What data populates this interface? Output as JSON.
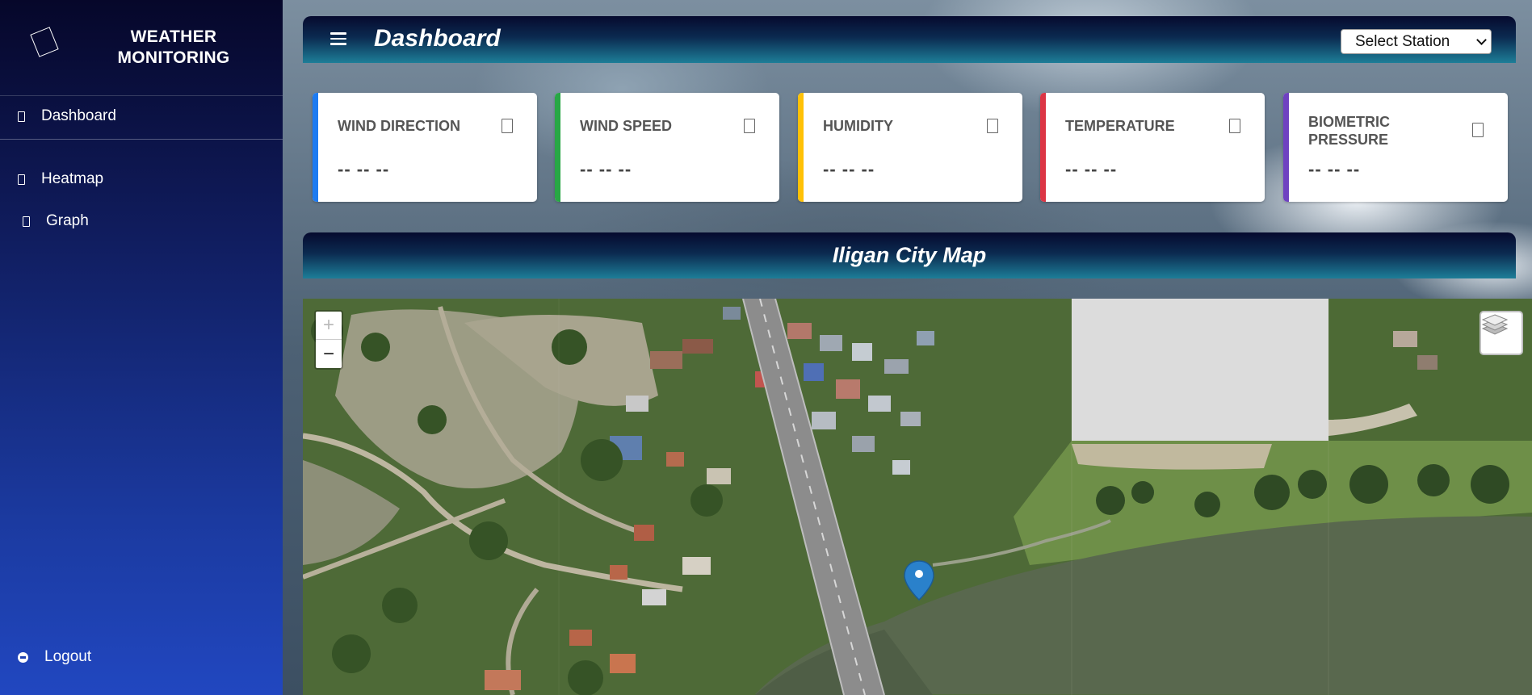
{
  "sidebar": {
    "brand_line1": "WEATHER",
    "brand_line2": "MONITORING",
    "items": [
      {
        "label": "Dashboard"
      },
      {
        "label": "Heatmap"
      },
      {
        "label": "Graph"
      }
    ],
    "logout_label": "Logout"
  },
  "header": {
    "title": "Dashboard",
    "station_select": {
      "selected": "Select Station"
    }
  },
  "cards": [
    {
      "label": "WIND DIRECTION",
      "value": "-- -- --",
      "accent": "#1e7bf0"
    },
    {
      "label": "WIND SPEED",
      "value": "-- -- --",
      "accent": "#28a745"
    },
    {
      "label": "HUMIDITY",
      "value": "-- -- --",
      "accent": "#ffc107"
    },
    {
      "label": "TEMPERATURE",
      "value": "-- -- --",
      "accent": "#dc3545"
    },
    {
      "label_line1": "BIOMETRIC",
      "label_line2": "PRESSURE",
      "value": "-- -- --",
      "accent": "#6f42c1"
    }
  ],
  "map": {
    "title": "Iligan City Map",
    "zoom_in": "+",
    "zoom_out": "−"
  }
}
